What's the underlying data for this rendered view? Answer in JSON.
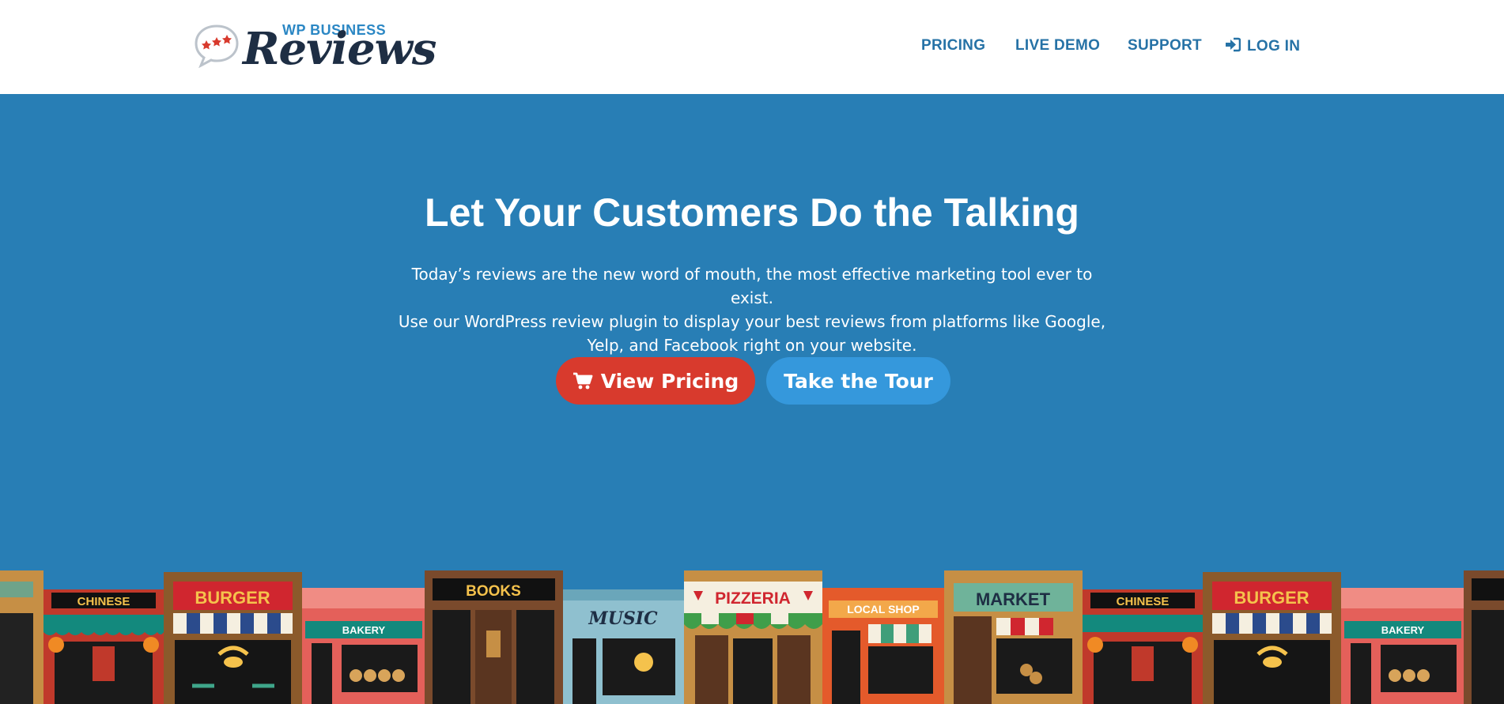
{
  "brand": {
    "small": "WP BUSINESS",
    "big": "Reviews"
  },
  "nav": {
    "pricing": "PRICING",
    "live_demo": "LIVE DEMO",
    "support": "SUPPORT",
    "login": "LOG IN",
    "login_icon": "sign-in-icon"
  },
  "hero": {
    "title": "Let Your Customers Do the Talking",
    "subtitle_lines": [
      "Today’s reviews are the new word of mouth, the most effective marketing tool ever to exist.",
      "Use our WordPress review plugin to display your best reviews from platforms like Google,",
      "Yelp, and Facebook right on your website."
    ],
    "primary_button": "View Pricing",
    "primary_icon": "shopping-cart-icon",
    "secondary_button": "Take the Tour"
  },
  "storefronts": [
    {
      "sign": "CHINESE"
    },
    {
      "sign": "BURGER"
    },
    {
      "sign": "BAKERY"
    },
    {
      "sign": "BOOKS"
    },
    {
      "sign": "MUSIC"
    },
    {
      "sign": "PIZZERIA"
    },
    {
      "sign": "LOCAL SHOP"
    },
    {
      "sign": "MARKET"
    },
    {
      "sign": "CHINESE"
    },
    {
      "sign": "BURGER"
    },
    {
      "sign": "BAKERY"
    }
  ],
  "colors": {
    "hero_bg": "#287eb5",
    "nav_text": "#2672a6",
    "primary_button": "#d83a2d",
    "secondary_button": "#3598dc",
    "logo_dark": "#1e2e44",
    "logo_blue": "#2b87c4"
  }
}
